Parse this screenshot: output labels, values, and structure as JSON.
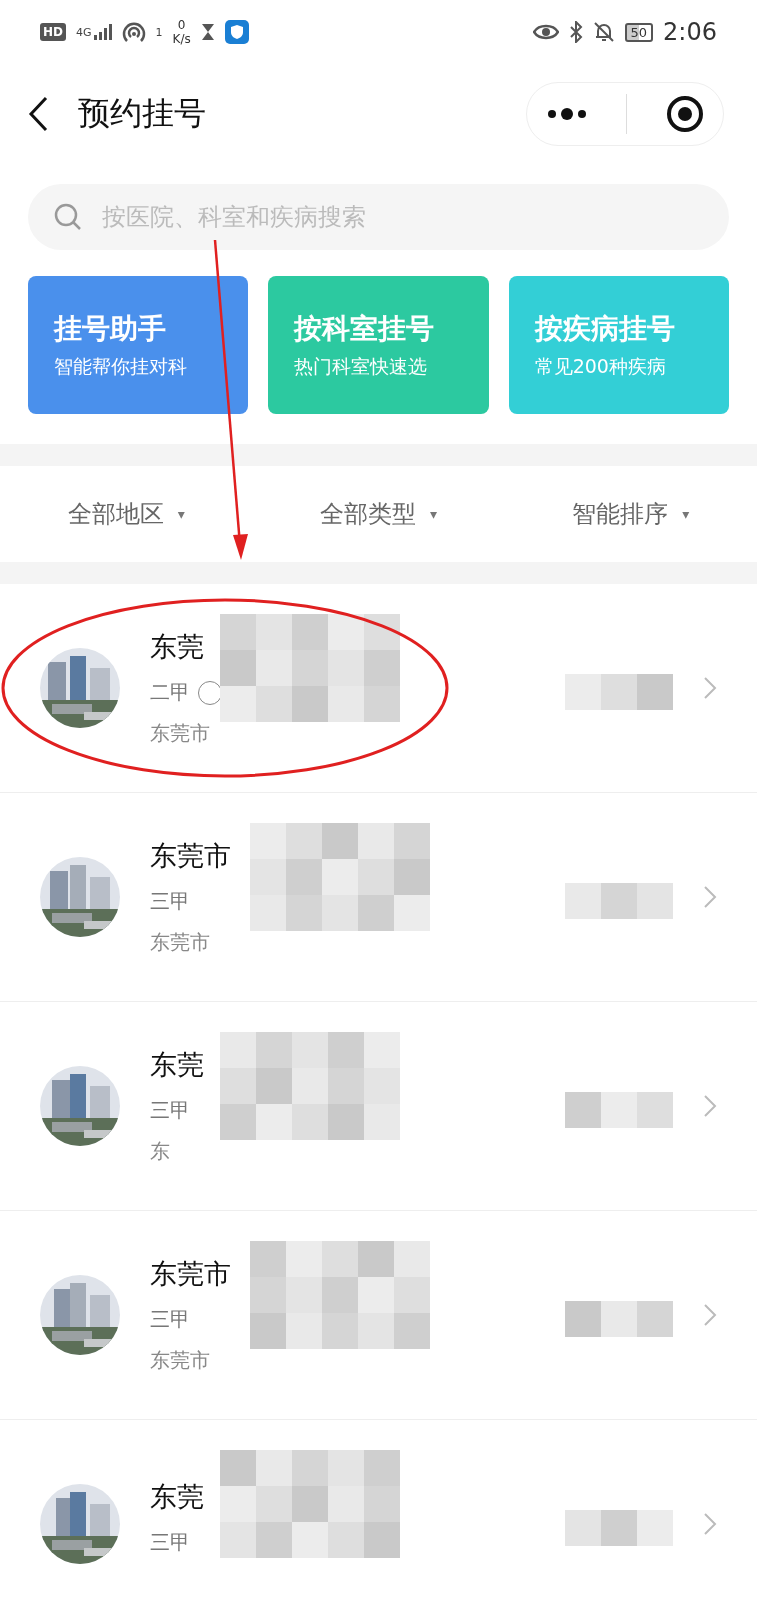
{
  "status_bar": {
    "left": {
      "net": "HD",
      "signal": "4G",
      "wifi_count": "1",
      "speed_value": "0",
      "speed_unit": "K/s"
    },
    "battery": "50",
    "time": "2:06"
  },
  "header": {
    "title": "预约挂号"
  },
  "search": {
    "placeholder": "按医院、科室和疾病搜索"
  },
  "shortcuts": [
    {
      "title": "挂号助手",
      "subtitle": "智能帮你挂对科",
      "color": "#4a90ec"
    },
    {
      "title": "按科室挂号",
      "subtitle": "热门科室快速选",
      "color": "#2cc9a0"
    },
    {
      "title": "按疾病挂号",
      "subtitle": "常见200种疾病",
      "color": "#33cfd6"
    }
  ],
  "filters": [
    {
      "label": "全部地区",
      "caret": "▾"
    },
    {
      "label": "全部类型",
      "caret": "▾"
    },
    {
      "label": "智能排序",
      "caret": "▾"
    }
  ],
  "hospitals": [
    {
      "name": "东莞",
      "level": "二甲",
      "badge": true,
      "address": "东莞市"
    },
    {
      "name": "东莞市",
      "level": "三甲",
      "badge": false,
      "address": "东莞市"
    },
    {
      "name": "东莞",
      "level": "三甲",
      "badge": false,
      "address": "东"
    },
    {
      "name": "东莞市",
      "level": "三甲",
      "badge": false,
      "address": "东莞市"
    },
    {
      "name": "东莞",
      "level": "三甲",
      "badge": false
    }
  ]
}
